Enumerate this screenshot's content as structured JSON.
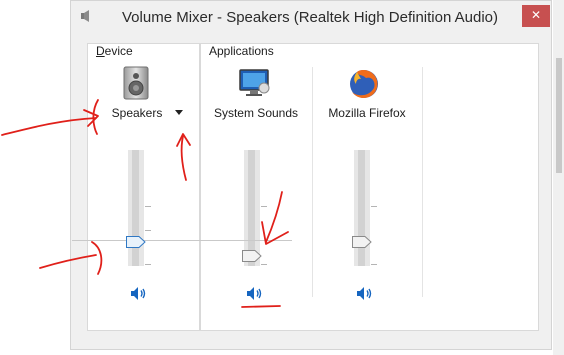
{
  "window": {
    "title": "Volume Mixer - Speakers (Realtek High Definition Audio)",
    "close_glyph": "✕",
    "close_color": "#c75050"
  },
  "sections": {
    "device_label_first": "D",
    "device_label_rest": "evice",
    "applications_label": "Applications"
  },
  "channels": [
    {
      "name": "Speakers",
      "icon": "speaker-device-icon",
      "has_dropdown": true,
      "volume_fraction": 0.25,
      "muted": false
    },
    {
      "name": "System Sounds",
      "icon": "system-sounds-icon",
      "volume_fraction": 0.09,
      "muted": false
    },
    {
      "name": "Mozilla Firefox",
      "icon": "firefox-icon",
      "volume_fraction": 0.25,
      "muted": false
    }
  ],
  "colors": {
    "slider_thumb": "#2f78c4",
    "annotation_ink": "#e0201a",
    "speaker_icon": "#1565c0"
  }
}
